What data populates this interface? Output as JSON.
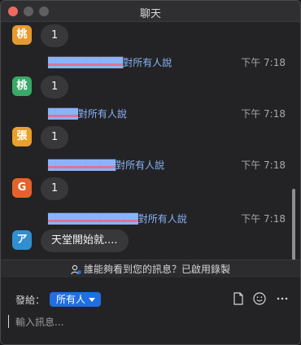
{
  "window": {
    "title": "聊天"
  },
  "colors": {
    "avatar_orange": "#e59a2e",
    "avatar_green": "#3aa866",
    "avatar_amber": "#e8a12a",
    "avatar_red_orange": "#e5622b",
    "avatar_blue": "#2f8fd0",
    "accent_blue": "#1f6fe0",
    "link_blue": "#8ab4f8"
  },
  "messages": [
    {
      "avatar": "桃",
      "text": "1"
    },
    {
      "sender": "██████████",
      "to": "對所有人說",
      "time": "下午 7:18",
      "avatar": "桃",
      "text": "1"
    },
    {
      "sender": "████",
      "to": "對所有人說",
      "time": "下午 7:18",
      "avatar": "張",
      "text": "1"
    },
    {
      "sender": "█████████",
      "to": "對所有人說",
      "time": "下午 7:18",
      "avatar": "G",
      "text": "1"
    },
    {
      "sender": "████████████",
      "to": "對所有人說",
      "time": "下午 7:18",
      "avatar": "ア",
      "text": "天堂開始就...."
    }
  ],
  "notice": {
    "text": "誰能夠看到您的訊息？已啟用錄製"
  },
  "composer": {
    "send_to_label": "發給：",
    "recipient": "所有人",
    "placeholder": "輸入訊息..."
  }
}
